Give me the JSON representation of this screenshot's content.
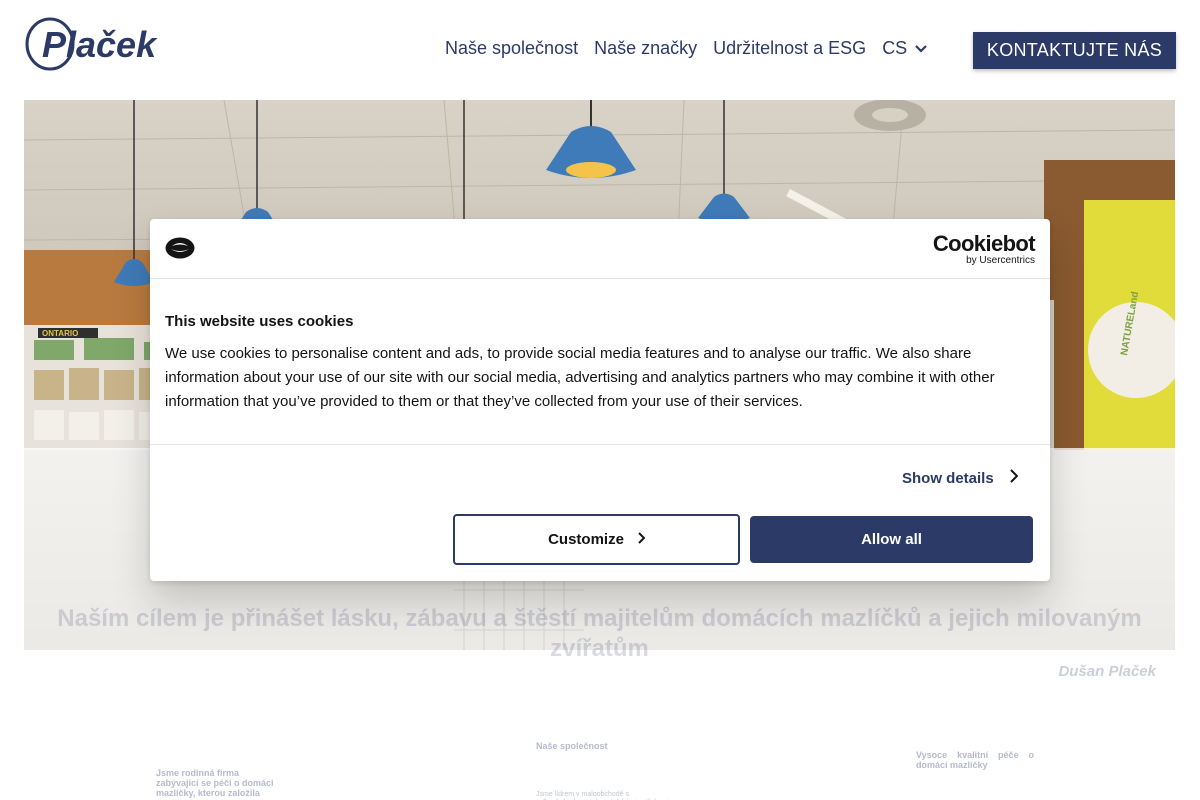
{
  "brand": {
    "logo_text": "Plaček",
    "accent": "#2b3a67"
  },
  "nav": {
    "items": [
      {
        "label": "Naše společnost"
      },
      {
        "label": "Naše značky"
      },
      {
        "label": "Udržitelnost a ESG"
      }
    ],
    "language": "CS",
    "contact_label": "KONTAKTUJTE NÁS"
  },
  "hero": {
    "quote": "Naším cílem je přinášet lásku, zábavu a štěstí majitelům domácích mazlíčků a jejich milovaným zvířatům",
    "author": "Dušan Plaček",
    "store_signs": [
      "ONTARIO",
      "NATURELand"
    ]
  },
  "sections": {
    "col1": "Jsme rodinná firma zabývající se péčí o domácí mazlíčky, kterou založila",
    "col2_title": "Naše společnost",
    "col2_sub": "Jsme lídrem v maloobchodě s velkoobchodem s chovatelskými potřebami",
    "col3": "Vysoce kvalitní péče o domácí mazlíčky"
  },
  "cookie": {
    "brand_main": "Cookiebot",
    "brand_sub": "by Usercentrics",
    "title": "This website uses cookies",
    "text": "We use cookies to personalise content and ads, to provide social media features and to analyse our traffic. We also share information about your use of our site with our social media, advertising and analytics partners who may combine it with other information that you’ve provided to them or that they’ve collected from your use of their services.",
    "show_details": "Show details",
    "customize": "Customize",
    "allow_all": "Allow all"
  }
}
